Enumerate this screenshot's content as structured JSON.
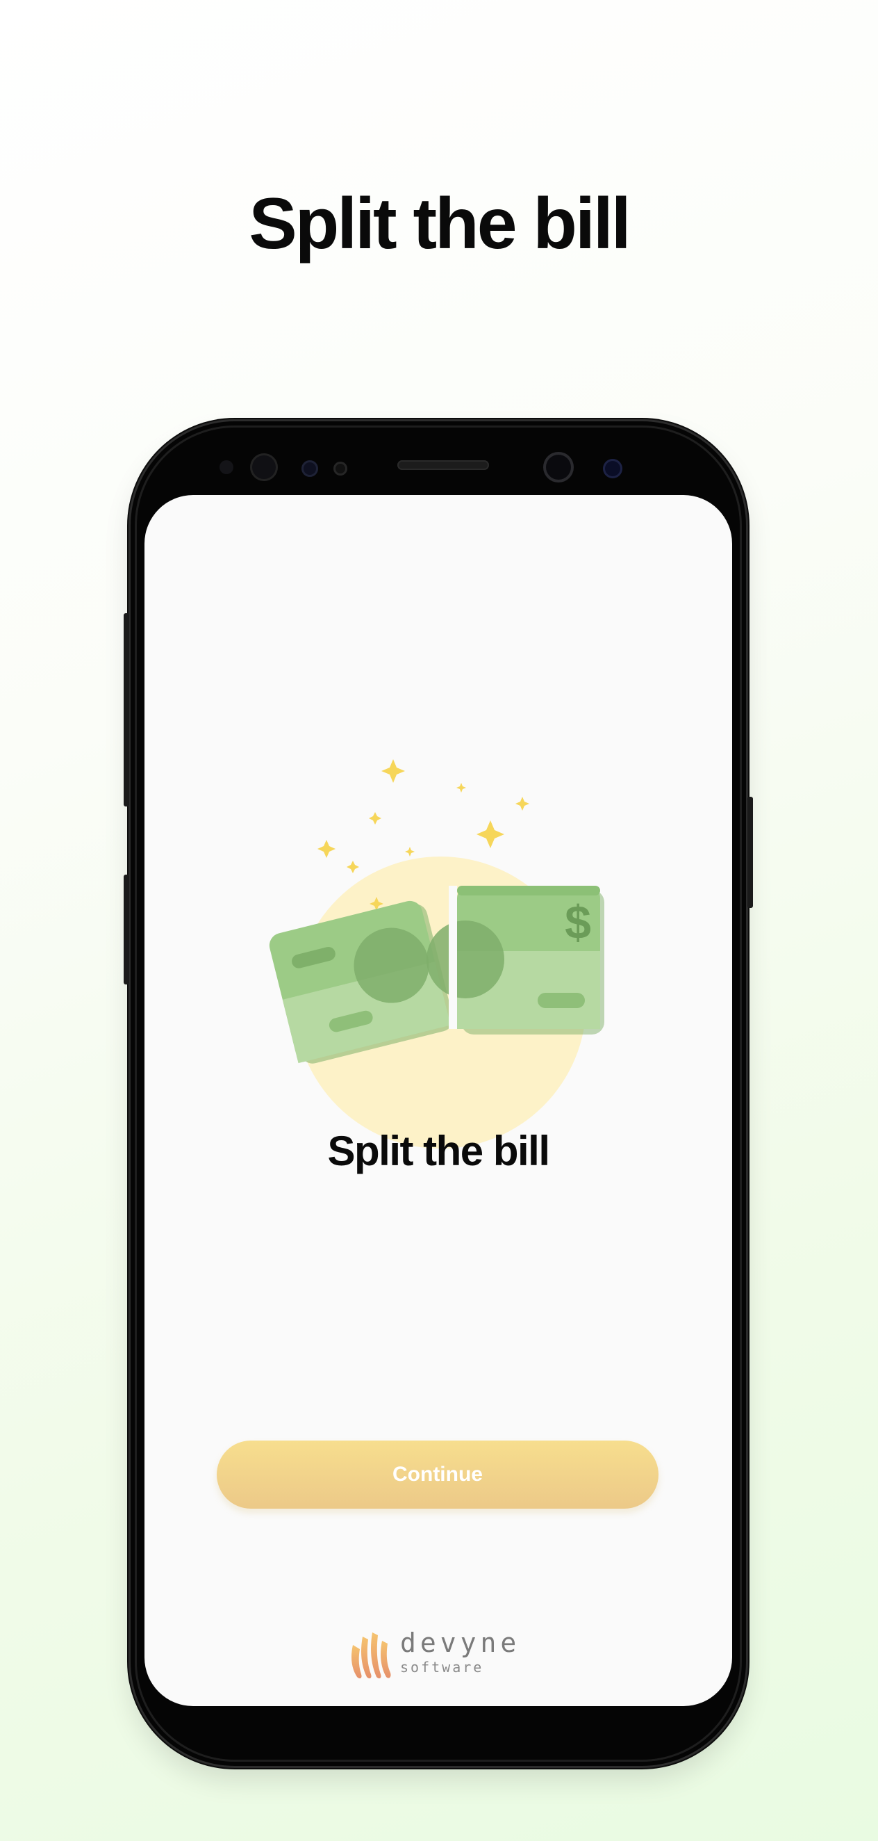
{
  "page": {
    "title": "Split the bill"
  },
  "screen": {
    "title": "Split the bill",
    "continue_label": "Continue",
    "illustration": {
      "icon": "money-split-icon",
      "currency_symbol": "$"
    },
    "logo": {
      "name": "devyne",
      "subtitle": "software"
    }
  },
  "colors": {
    "bill_green": "#9ccb86",
    "bill_dark": "#7fb06a",
    "sun_yellow": "#fdf1c6",
    "sparkle": "#f6d65a",
    "button": "#f3d48c"
  }
}
